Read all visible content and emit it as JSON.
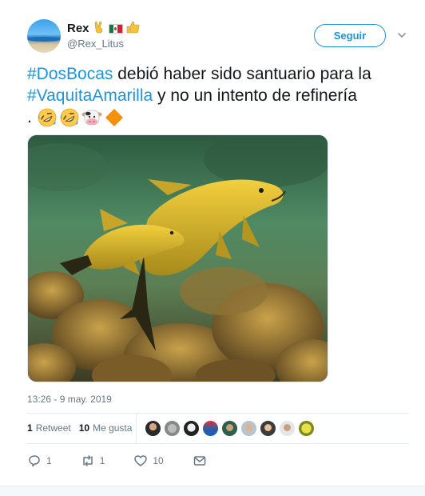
{
  "user": {
    "display_name": "Rex",
    "handle": "@Rex_Litus",
    "name_emojis": [
      "victory-hand",
      "mexico-flag",
      "thumbs-up"
    ]
  },
  "follow_label": "Seguir",
  "text": {
    "hashtag1": "#DosBocas",
    "part1": " debió haber sido santuario para la ",
    "hashtag2": "#VaquitaAmarilla",
    "part2": " y no un intento de refinería",
    "trailing": ". ",
    "emojis": [
      "rolling-on-floor-laughing",
      "rolling-on-floor-laughing",
      "cow-face",
      "orange-diamond"
    ]
  },
  "media": {
    "kind": "photo"
  },
  "timestamp": "13:26 - 9 may. 2019",
  "stats": {
    "retweets_count": "1",
    "retweets_label": "Retweet",
    "likes_count": "10",
    "likes_label": "Me gusta"
  },
  "likers_count": 9,
  "actions": {
    "reply_count": "1",
    "retweet_count": "1",
    "like_count": "10"
  },
  "colors": {
    "link": "#1b95e0",
    "secondary_text": "#657786",
    "primary_text": "#14171a"
  }
}
